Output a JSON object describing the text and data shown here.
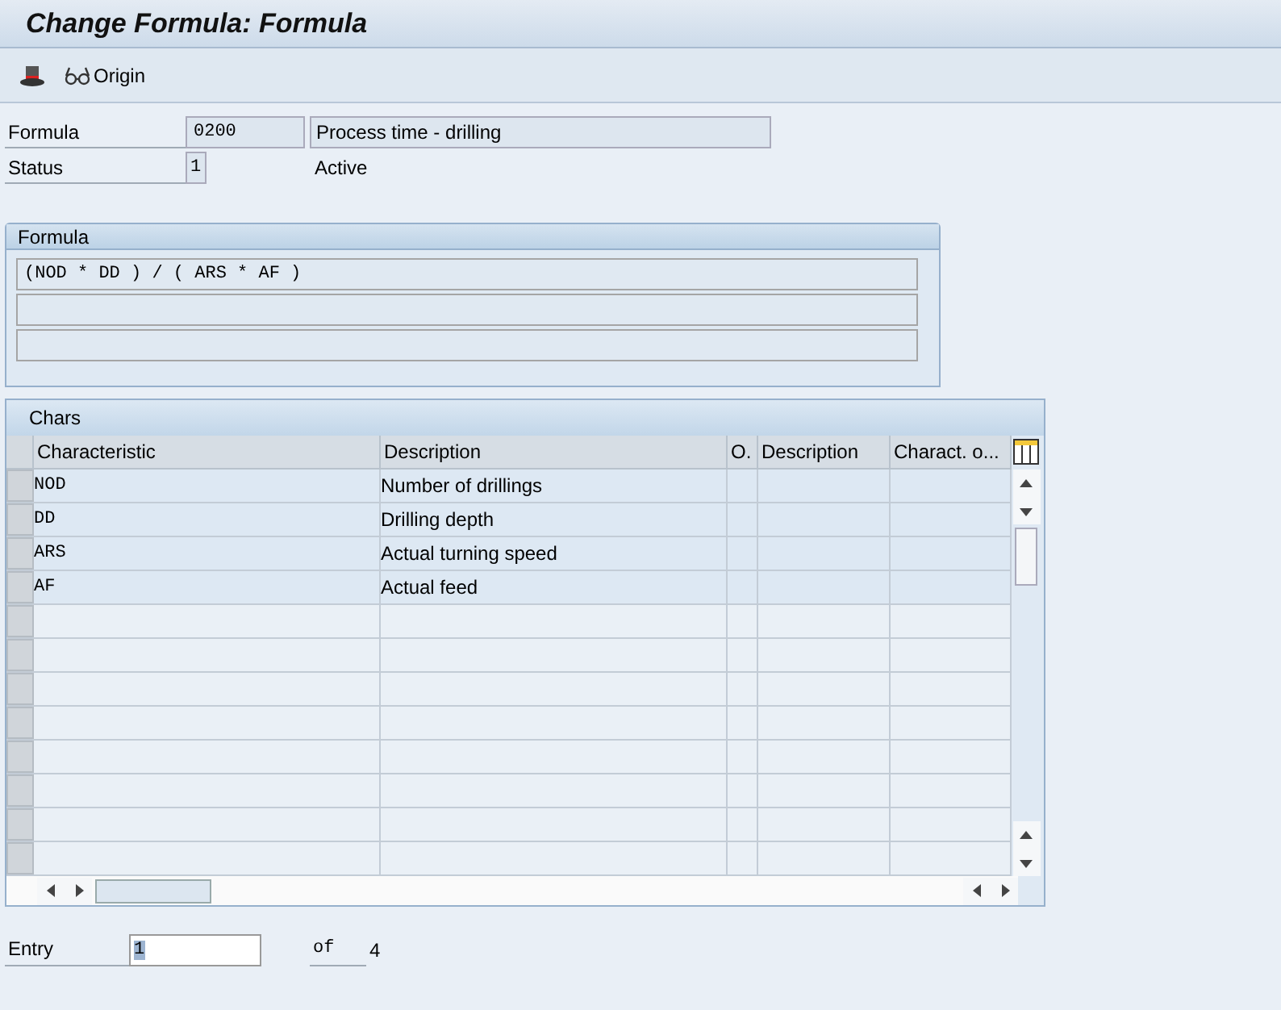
{
  "window": {
    "title": "Change Formula: Formula"
  },
  "toolbar": {
    "buttons": [
      {
        "kind": "hat"
      },
      {
        "kind": "glasses",
        "label": "Origin"
      }
    ]
  },
  "header_fields": [
    {
      "label": "Formula",
      "value": "0200",
      "description": "Process time - drilling"
    },
    {
      "label": "Status",
      "value": "1",
      "description": "Active"
    }
  ],
  "formula_group": {
    "title": "Formula",
    "lines": [
      "(NOD * DD ) / ( ARS * AF )"
    ]
  },
  "chars_table": {
    "title": "Chars",
    "columns": [
      "Characteristic",
      "Description",
      "O.",
      "Description",
      "Charact. o..."
    ],
    "rows": [
      [
        "NOD",
        "Number of drillings"
      ],
      [
        "DD",
        "Drilling depth"
      ],
      [
        "ARS",
        "Actual turning speed"
      ],
      [
        "AF",
        "Actual feed"
      ]
    ]
  },
  "entry": {
    "label": "Entry",
    "value": "1",
    "of_label": "of",
    "total": "4"
  }
}
